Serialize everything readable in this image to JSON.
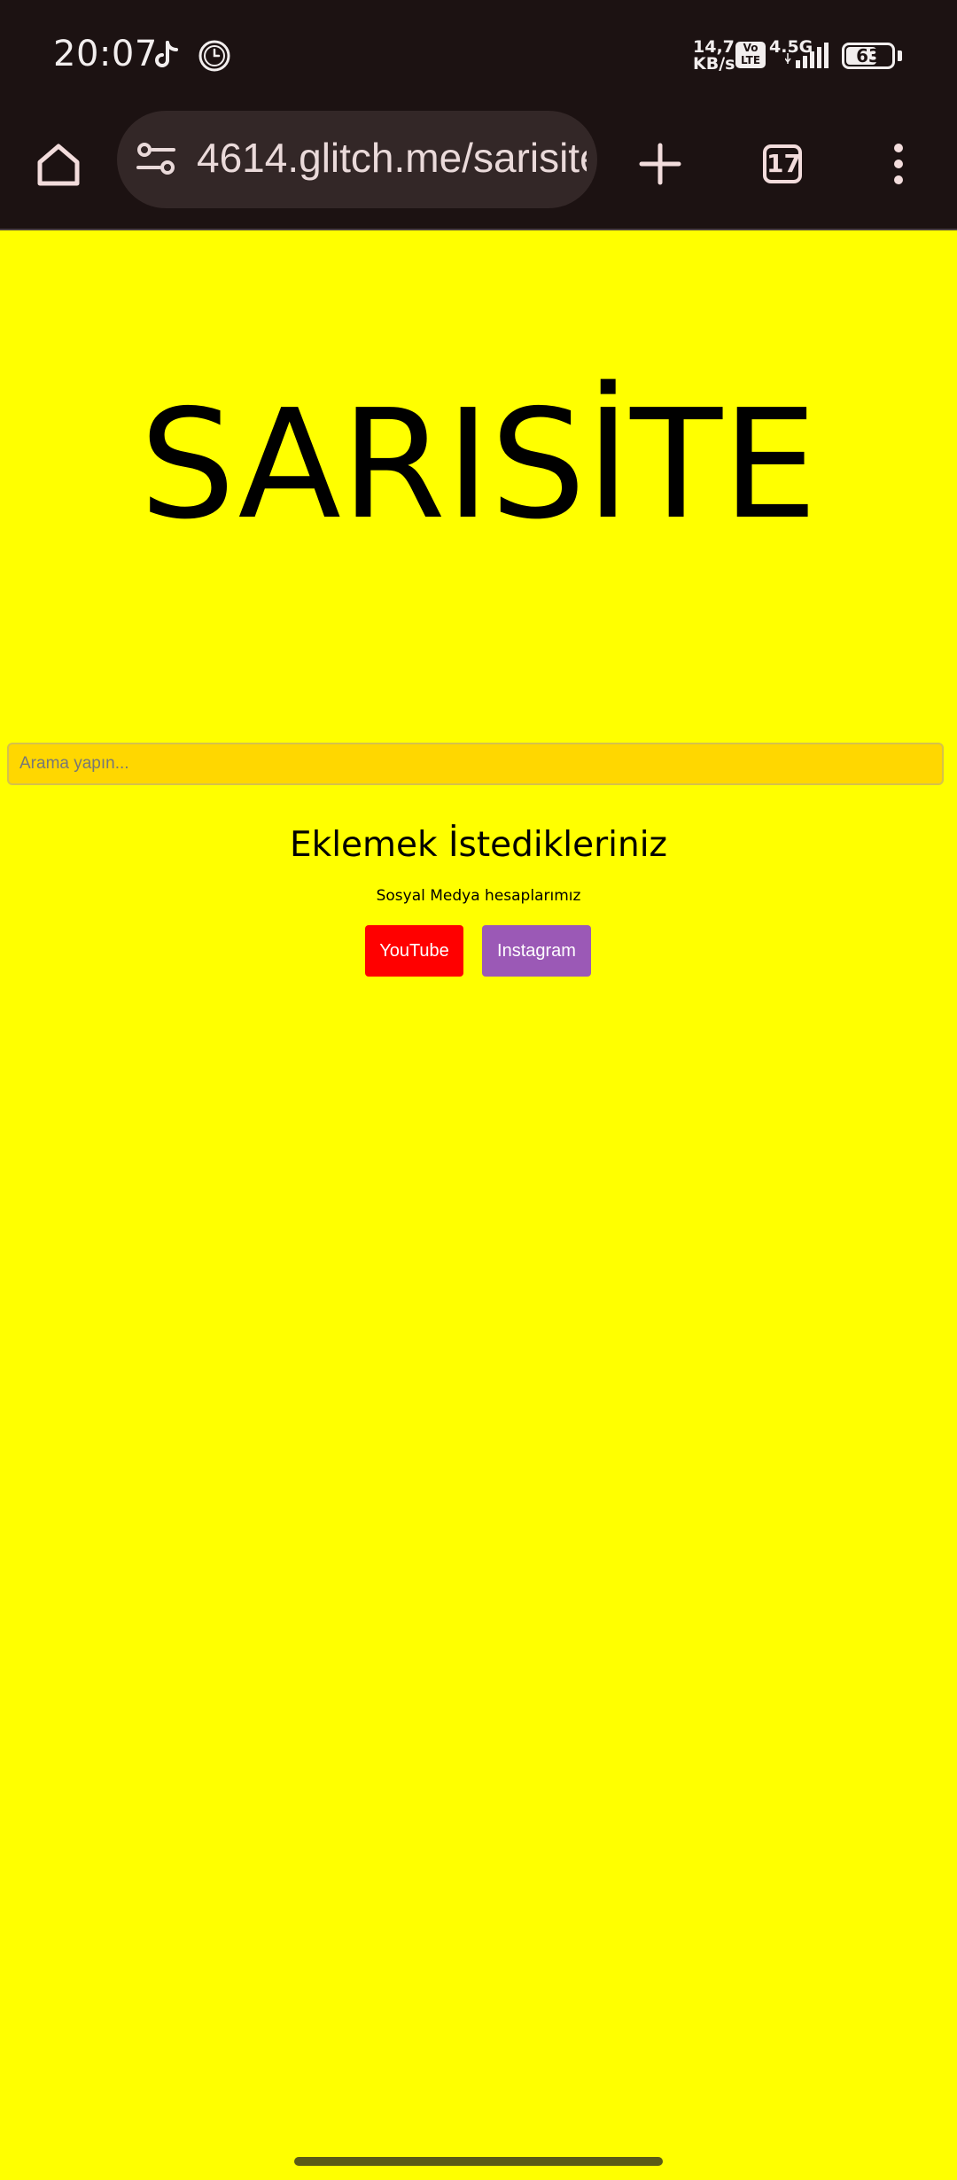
{
  "status_bar": {
    "time": "20:07",
    "icons": [
      "tiktok-icon",
      "clock-icon"
    ],
    "net_speed_value": "14,7",
    "net_speed_unit": "KB/s",
    "volte_line1": "Vo",
    "volte_line2": "LTE",
    "network_type": "4.5G",
    "battery_level": "63"
  },
  "browser": {
    "address": "4614.glitch.me/sarisite",
    "tabs_count": "17",
    "icons": [
      "home-icon",
      "site-settings-icon",
      "new-tab-icon",
      "tab-switcher-icon",
      "more-menu-icon"
    ]
  },
  "page": {
    "title": "SARISİTE",
    "search_placeholder": "Arama yapın...",
    "section_heading": "Eklemek İstedikleriniz",
    "section_sub": "Sosyal Medya hesaplarımız",
    "buttons": {
      "youtube": "YouTube",
      "instagram": "Instagram"
    }
  },
  "colors": {
    "page_background": "#ffff00",
    "search_background": "#ffd700",
    "youtube_button": "#ff0000",
    "instagram_button": "#9b59b6",
    "chrome_background": "#1c1212"
  }
}
